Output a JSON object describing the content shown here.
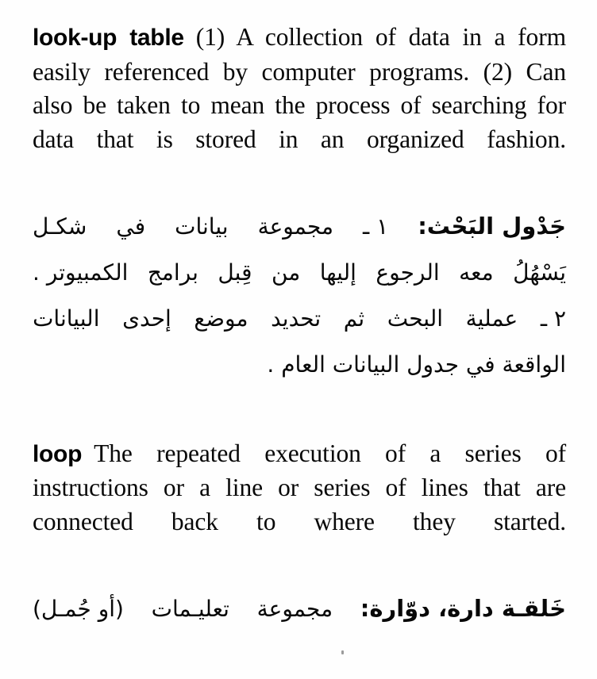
{
  "page": {
    "background_color": "#fefefe",
    "text_color": "#080808",
    "artifact": "scan-speck"
  },
  "entries": [
    {
      "headword": "look-up table",
      "english_definition": "(1) A collection of data in a form easily referenced by computer programs. (2) Can also be taken to mean the process of searching for data that is stored in an organized fashion.",
      "arabic_headword": "جَدْول البَحْث",
      "arabic_definition": "جَدْول البَحْث: ١ ـ مجموعة بيانات في شكل يَسْهُلُ معه الرجوع إليها من قِبل برامج الكمبيوتر . ٢ ـ عملية البحث ثم تحديد موضع إحدى البيانات الواقعة في جدول البيانات العام .",
      "arabic_lines": [
        {
          "segments": [
            "جَدْول البَحْث:",
            "١ ـ",
            "مجموعة",
            "بيانات",
            "في",
            "شكـل"
          ],
          "bold_first": true,
          "align": "justify"
        },
        {
          "segments": [
            "يَسْهُلُ",
            "معه",
            "الرجوع",
            "إليها",
            "من",
            "قِبل",
            "برامج",
            "الكمبيوتر ."
          ],
          "bold_first": false,
          "align": "justify"
        },
        {
          "segments": [
            "٢ ـ",
            "عملية",
            "البحث",
            "ثم",
            "تحديد",
            "موضع",
            "إحدى",
            "البيانات"
          ],
          "bold_first": false,
          "align": "justify"
        },
        {
          "segments": [
            "الواقعة في جدول البيانات العام ."
          ],
          "bold_first": false,
          "align": "right"
        }
      ]
    },
    {
      "headword": "loop",
      "english_definition": "The repeated execution of a series of instructions or a line or series of lines that are connected back to where they started.",
      "arabic_headword": "خَلقـة دارة، دوّارة",
      "arabic_definition": "خَلقـة دارة، دوّارة: مجموعة تعليمات (أو جُمل)",
      "arabic_lines": [
        {
          "segments": [
            "خَلقـة دارة، دوّارة:",
            "مجموعة",
            "تعليـمات",
            "(أو جُمـل)"
          ],
          "bold_first": true,
          "align": "justify"
        }
      ]
    }
  ]
}
